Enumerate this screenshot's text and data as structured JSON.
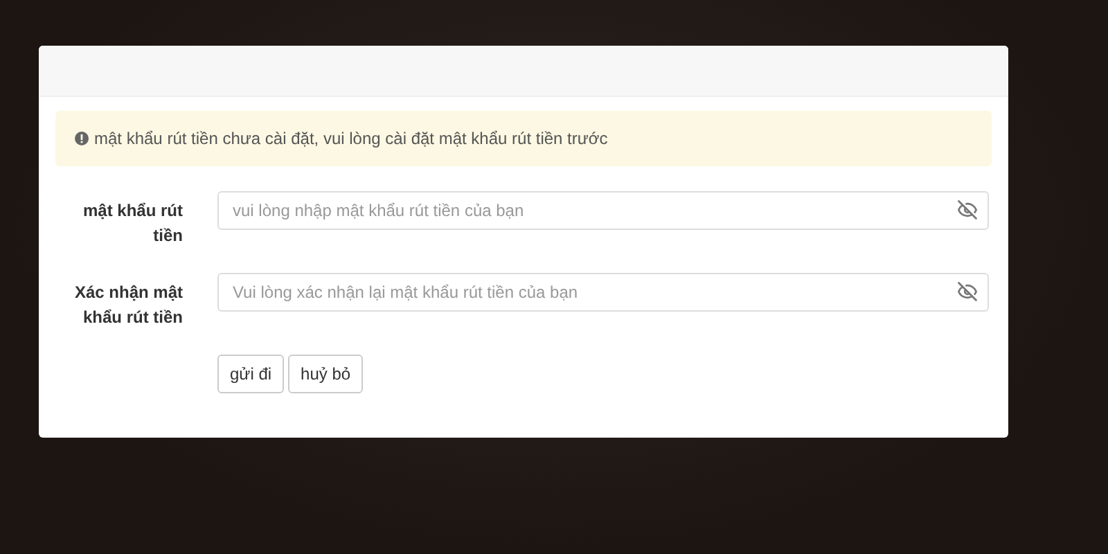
{
  "alert": {
    "text": "mật khẩu rút tiền chưa cài đặt, vui lòng cài đặt mật khẩu rút tiền trước"
  },
  "fields": [
    {
      "label": "mật khẩu rút tiền",
      "placeholder": "vui lòng nhập mật khẩu rút tiền của bạn",
      "masked": true
    },
    {
      "label": "Xác nhận mật khẩu rút tiền",
      "placeholder": "Vui lòng xác nhận lại mật khẩu rút tiền của bạn",
      "masked": true
    }
  ],
  "buttons": [
    "gửi đi",
    "huỷ bỏ"
  ]
}
